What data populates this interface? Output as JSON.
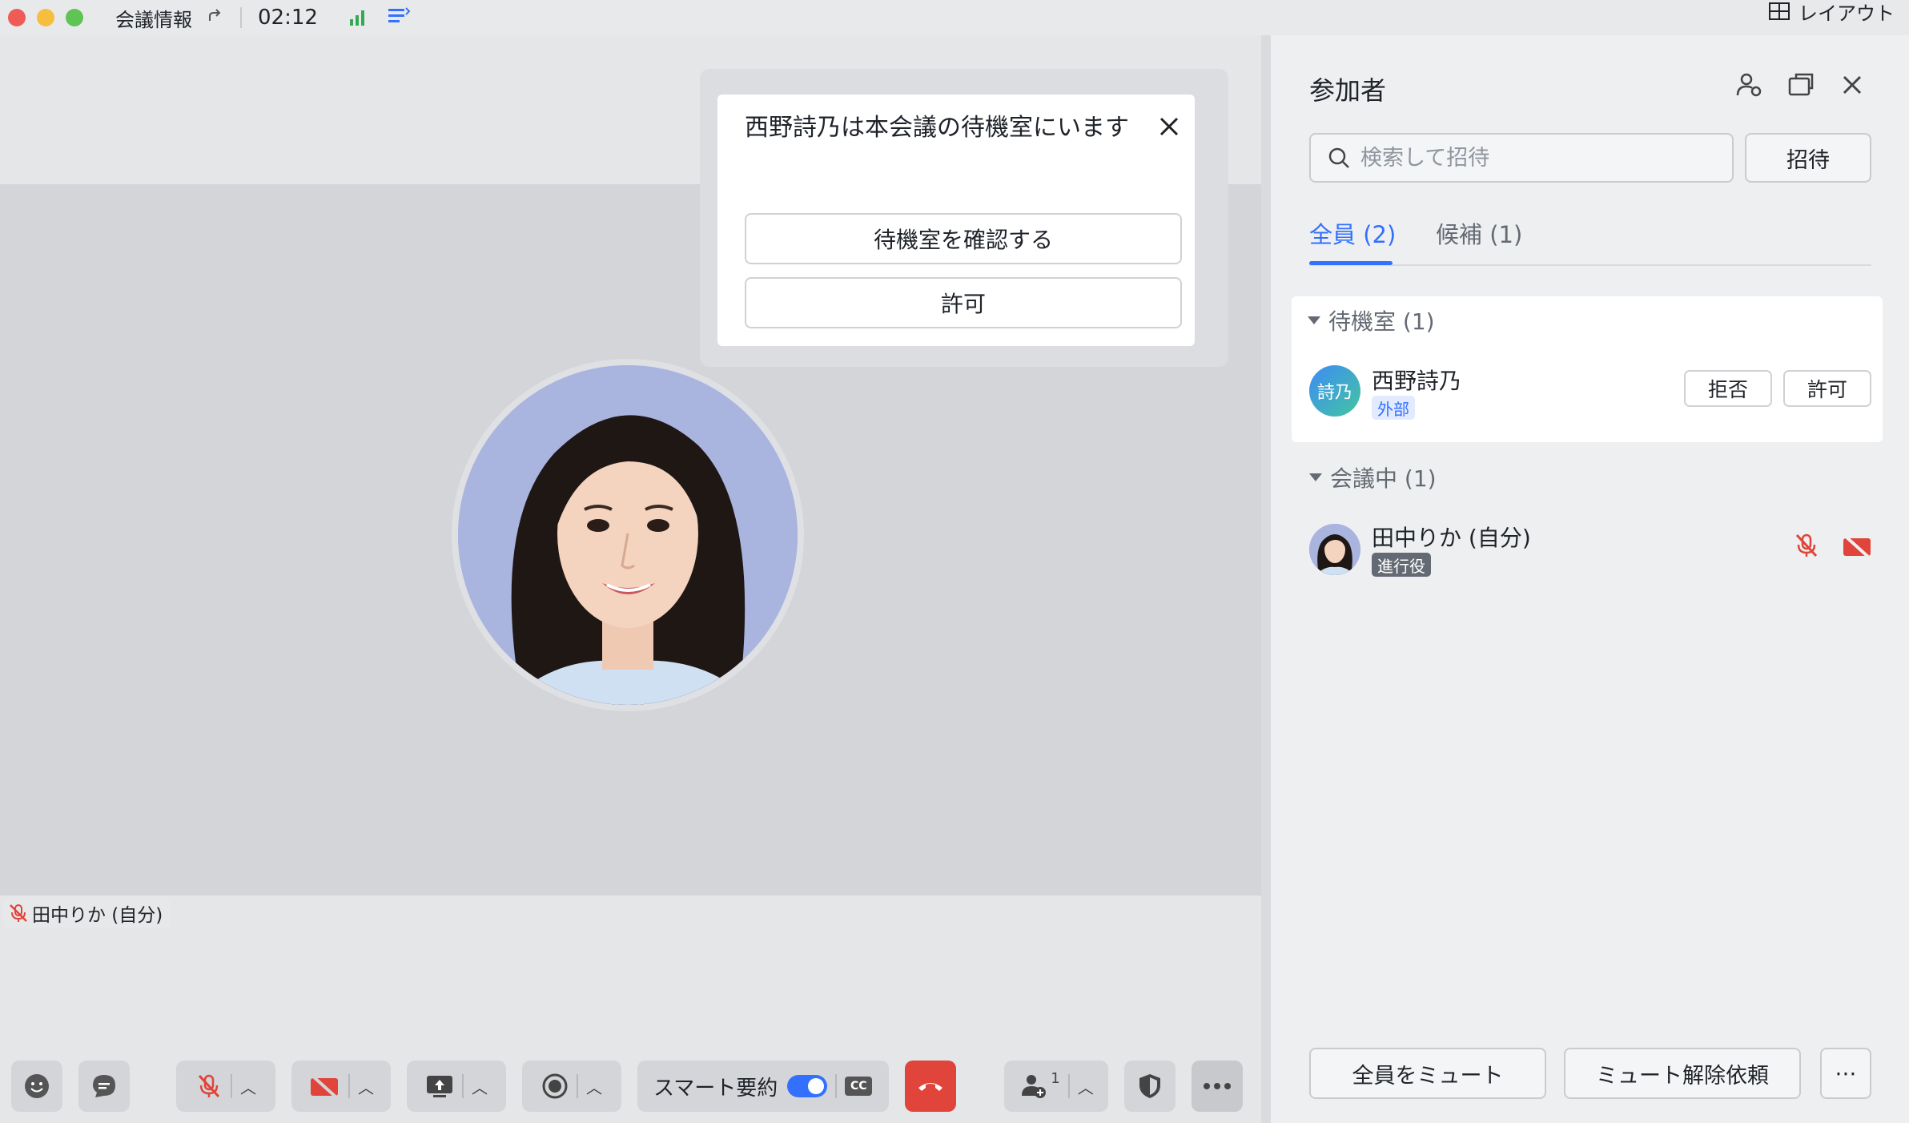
{
  "titlebar": {
    "meeting_info": "会議情報",
    "time": "02:12",
    "layout_label": "レイアウト"
  },
  "stage": {
    "self_name_tag": "田中りか (自分)"
  },
  "popup": {
    "message": "西野詩乃は本会議の待機室にいます",
    "view_waiting_room": "待機室を確認する",
    "admit": "許可"
  },
  "toolbar": {
    "smart_summary": "スマート要約",
    "cc": "CC",
    "participants_count": "1"
  },
  "panel": {
    "title": "参加者",
    "search_placeholder": "検索して招待",
    "invite": "招待",
    "tabs": [
      {
        "label": "全員 (2)"
      },
      {
        "label": "候補 (1)"
      }
    ],
    "waiting_section": "待機室 (1)",
    "waiting_person": {
      "initials": "詩乃",
      "name": "西野詩乃",
      "badge": "外部",
      "reject": "拒否",
      "admit": "許可"
    },
    "in_meeting_section": "会議中 (1)",
    "in_meeting_person": {
      "name": "田中りか (自分)",
      "badge": "進行役"
    },
    "mute_all": "全員をミュート",
    "request_unmute": "ミュート解除依頼",
    "more": "⋯"
  },
  "colors": {
    "accent": "#3370ff",
    "end_call": "#e0443a",
    "muted_red": "#e0443a"
  }
}
